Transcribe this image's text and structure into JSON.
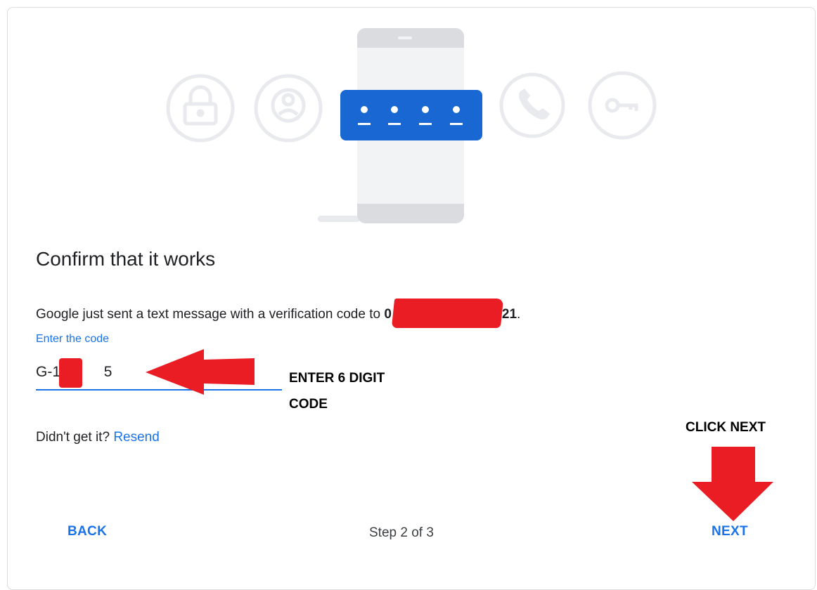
{
  "heading": "Confirm that it works",
  "message": {
    "prefix": "Google just sent a text message with a verification code to ",
    "phone_visible_start": "0",
    "phone_visible_end": "21",
    "suffix": "."
  },
  "code_field": {
    "label": "Enter the code",
    "value_prefix": "G-14",
    "value_suffix": "5"
  },
  "annotations": {
    "enter_hint_line1": "ENTER 6 DIGIT",
    "enter_hint_line2": "CODE",
    "click_next": "CLICK NEXT"
  },
  "resend_prompt": "Didn't get it?",
  "resend_link": "Resend",
  "footer": {
    "back": "BACK",
    "step": "Step 2 of 3",
    "next": "NEXT"
  },
  "colors": {
    "accent": "#1a73e8",
    "annotation_red": "#ea1c24"
  },
  "icons": [
    "lock-icon",
    "account-icon",
    "code-dots-icon",
    "phone-icon",
    "key-icon"
  ]
}
